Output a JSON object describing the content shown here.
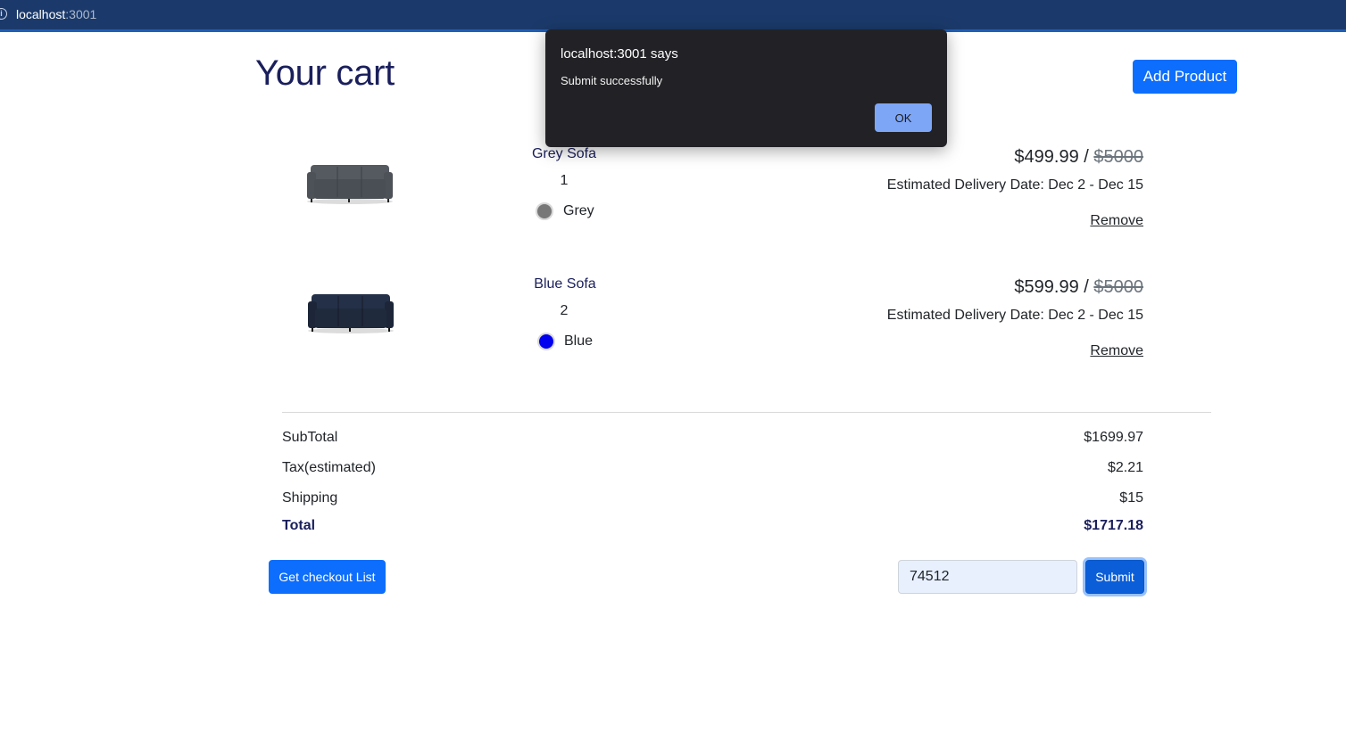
{
  "browser": {
    "url_host": "localhost",
    "url_port": ":3001",
    "info_icon": "info-icon"
  },
  "page": {
    "title": "Your cart",
    "add_product_label": "Add Product"
  },
  "items": [
    {
      "name": "Grey Sofa",
      "quantity": "1",
      "color_name": "Grey",
      "color_hex": "#777777",
      "price": "$499.99",
      "separator": " / ",
      "old_price": "$5000",
      "delivery": "Estimated Delivery Date: Dec 2 - Dec 15",
      "remove_label": "Remove",
      "sofa_color": "#4a4f55"
    },
    {
      "name": "Blue Sofa",
      "quantity": "2",
      "color_name": "Blue",
      "color_hex": "#0000ee",
      "price": "$599.99",
      "separator": " / ",
      "old_price": "$5000",
      "delivery": "Estimated Delivery Date: Dec 2 - Dec 15",
      "remove_label": "Remove",
      "sofa_color": "#1f2a3c"
    }
  ],
  "summary": {
    "subtotal_label": "SubTotal",
    "subtotal_value": "$1699.97",
    "tax_label": "Tax(estimated)",
    "tax_value": "$2.21",
    "shipping_label": "Shipping",
    "shipping_value": "$15",
    "total_label": "Total",
    "total_value": "$1717.18"
  },
  "actions": {
    "checkout_list_label": "Get checkout List",
    "zip_value": "74512",
    "submit_label": "Submit"
  },
  "dialog": {
    "title": "localhost:3001 says",
    "message": "Submit successfully",
    "ok_label": "OK"
  },
  "colors": {
    "primary": "#0d6efd",
    "title": "#1a1f5c",
    "urlbar": "#1b3a6b",
    "dialog_bg": "#222226",
    "dialog_ok": "#7ea6f7"
  }
}
